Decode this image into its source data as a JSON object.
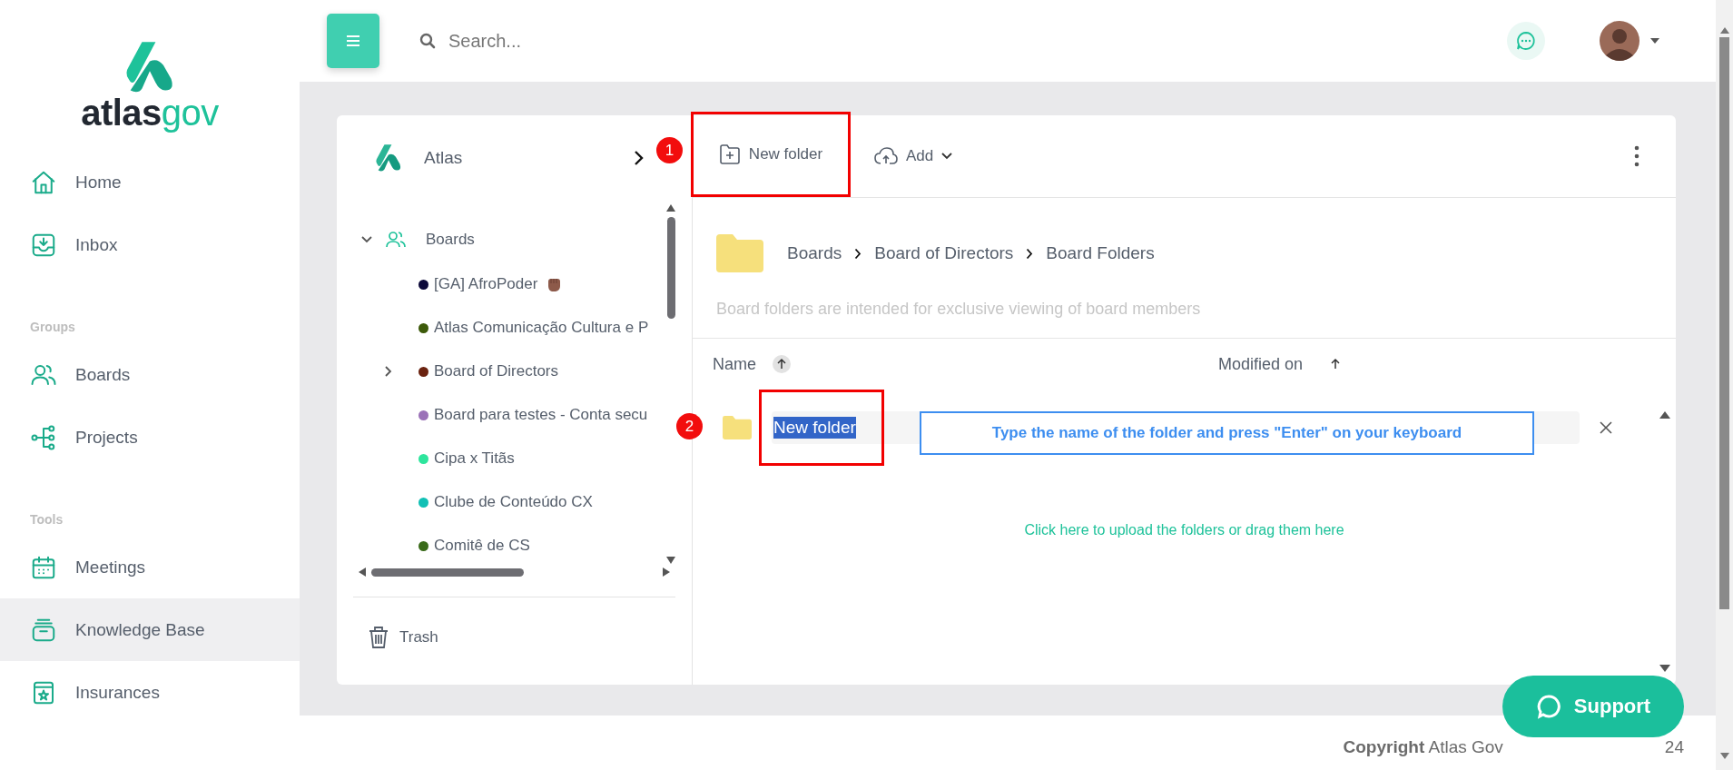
{
  "brand": {
    "dark": "atlas",
    "light": "gov"
  },
  "sidebar": {
    "sections": [
      {
        "items": [
          {
            "label": "Home",
            "selected": false
          },
          {
            "label": "Inbox",
            "selected": false
          }
        ]
      },
      {
        "title": "Groups",
        "items": [
          {
            "label": "Boards",
            "selected": false
          },
          {
            "label": "Projects",
            "selected": false
          }
        ]
      },
      {
        "title": "Tools",
        "items": [
          {
            "label": "Meetings",
            "selected": false
          },
          {
            "label": "Knowledge Base",
            "selected": true
          },
          {
            "label": "Insurances",
            "selected": false
          }
        ]
      }
    ]
  },
  "topbar": {
    "search": {
      "placeholder": "Search..."
    }
  },
  "tree": {
    "root": "Atlas",
    "group": {
      "label": "Boards",
      "expanded": true,
      "children": [
        {
          "label": "[GA] AfroPoder",
          "color": "#0d0a3a"
        },
        {
          "label": "Atlas Comunicação Cultura e P",
          "color": "#3d5a0a"
        },
        {
          "label": "Board of Directors",
          "color": "#6b2310",
          "expanded": false
        },
        {
          "label": "Board para testes - Conta secu",
          "color": "#9b72b8"
        },
        {
          "label": "Cipa x Titãs",
          "color": "#2ee59d"
        },
        {
          "label": "Clube de Conteúdo CX",
          "color": "#11c0b5"
        },
        {
          "label": "Comitê de CS",
          "color": "#3a6b1a"
        }
      ]
    },
    "trash": "Trash"
  },
  "toolbar": {
    "actions": [
      {
        "label": "New folder",
        "dropdown": false
      },
      {
        "label": "Add",
        "dropdown": true
      }
    ]
  },
  "breadcrumb": [
    "Boards",
    "Board of Directors",
    "Board Folders"
  ],
  "description": "Board folders are intended for exclusive viewing of board members",
  "table": {
    "columns": [
      {
        "label": "Name",
        "sorted": true
      },
      {
        "label": "Modified on",
        "sorted": false
      }
    ]
  },
  "new_row": {
    "value": "New folder",
    "text_selected": true
  },
  "tip": "Type the name of the folder and press \"Enter\" on your keyboard",
  "upload_link": "Click here to upload the folders or drag them here",
  "annotations": [
    {
      "number": "1"
    },
    {
      "number": "2"
    }
  ],
  "footer": {
    "copyright": "**Copyright** Atlas Gov",
    "tail": "24"
  },
  "support": {
    "label": "Support"
  }
}
